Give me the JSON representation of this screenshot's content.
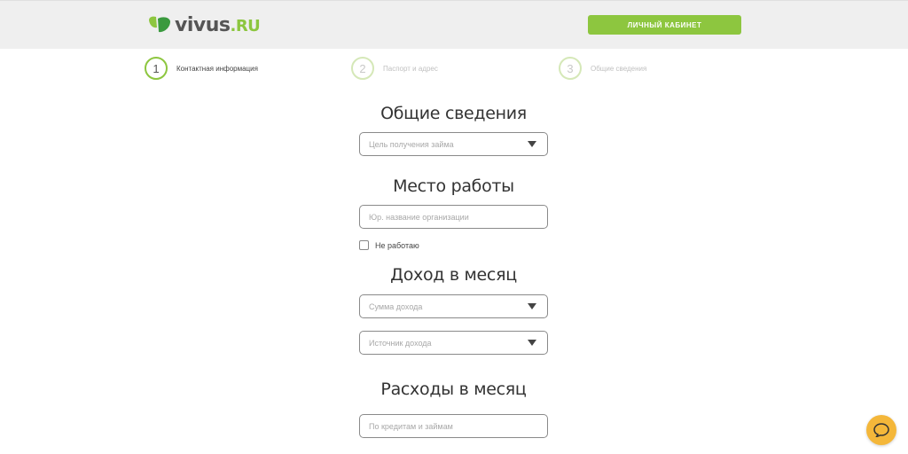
{
  "header": {
    "logo_text": "vivus",
    "logo_suffix": ".RU",
    "cabinet_button": "ЛИЧНЫЙ КАБИНЕТ"
  },
  "steps": [
    {
      "number": "1",
      "label": "Контактная информация",
      "active": true
    },
    {
      "number": "2",
      "label": "Паспорт и адрес",
      "active": false
    },
    {
      "number": "3",
      "label": "Общие сведения",
      "active": false
    }
  ],
  "sections": {
    "general": {
      "title": "Общие сведения",
      "loan_purpose_placeholder": "Цель получения займа"
    },
    "work": {
      "title": "Место работы",
      "org_name_placeholder": "Юр. название организации",
      "not_working_label": "Не работаю"
    },
    "income": {
      "title": "Доход в месяц",
      "amount_placeholder": "Сумма дохода",
      "source_placeholder": "Источник дохода"
    },
    "expenses": {
      "title": "Расходы в месяц",
      "credits_placeholder": "По кредитам и займам"
    }
  },
  "colors": {
    "brand_green": "#8dc63f",
    "chat_orange": "#f4b73a"
  },
  "icons": {
    "logo": "vivus-leaf-icon",
    "chat": "chat-bubble-icon",
    "dropdown": "chevron-down-icon"
  }
}
